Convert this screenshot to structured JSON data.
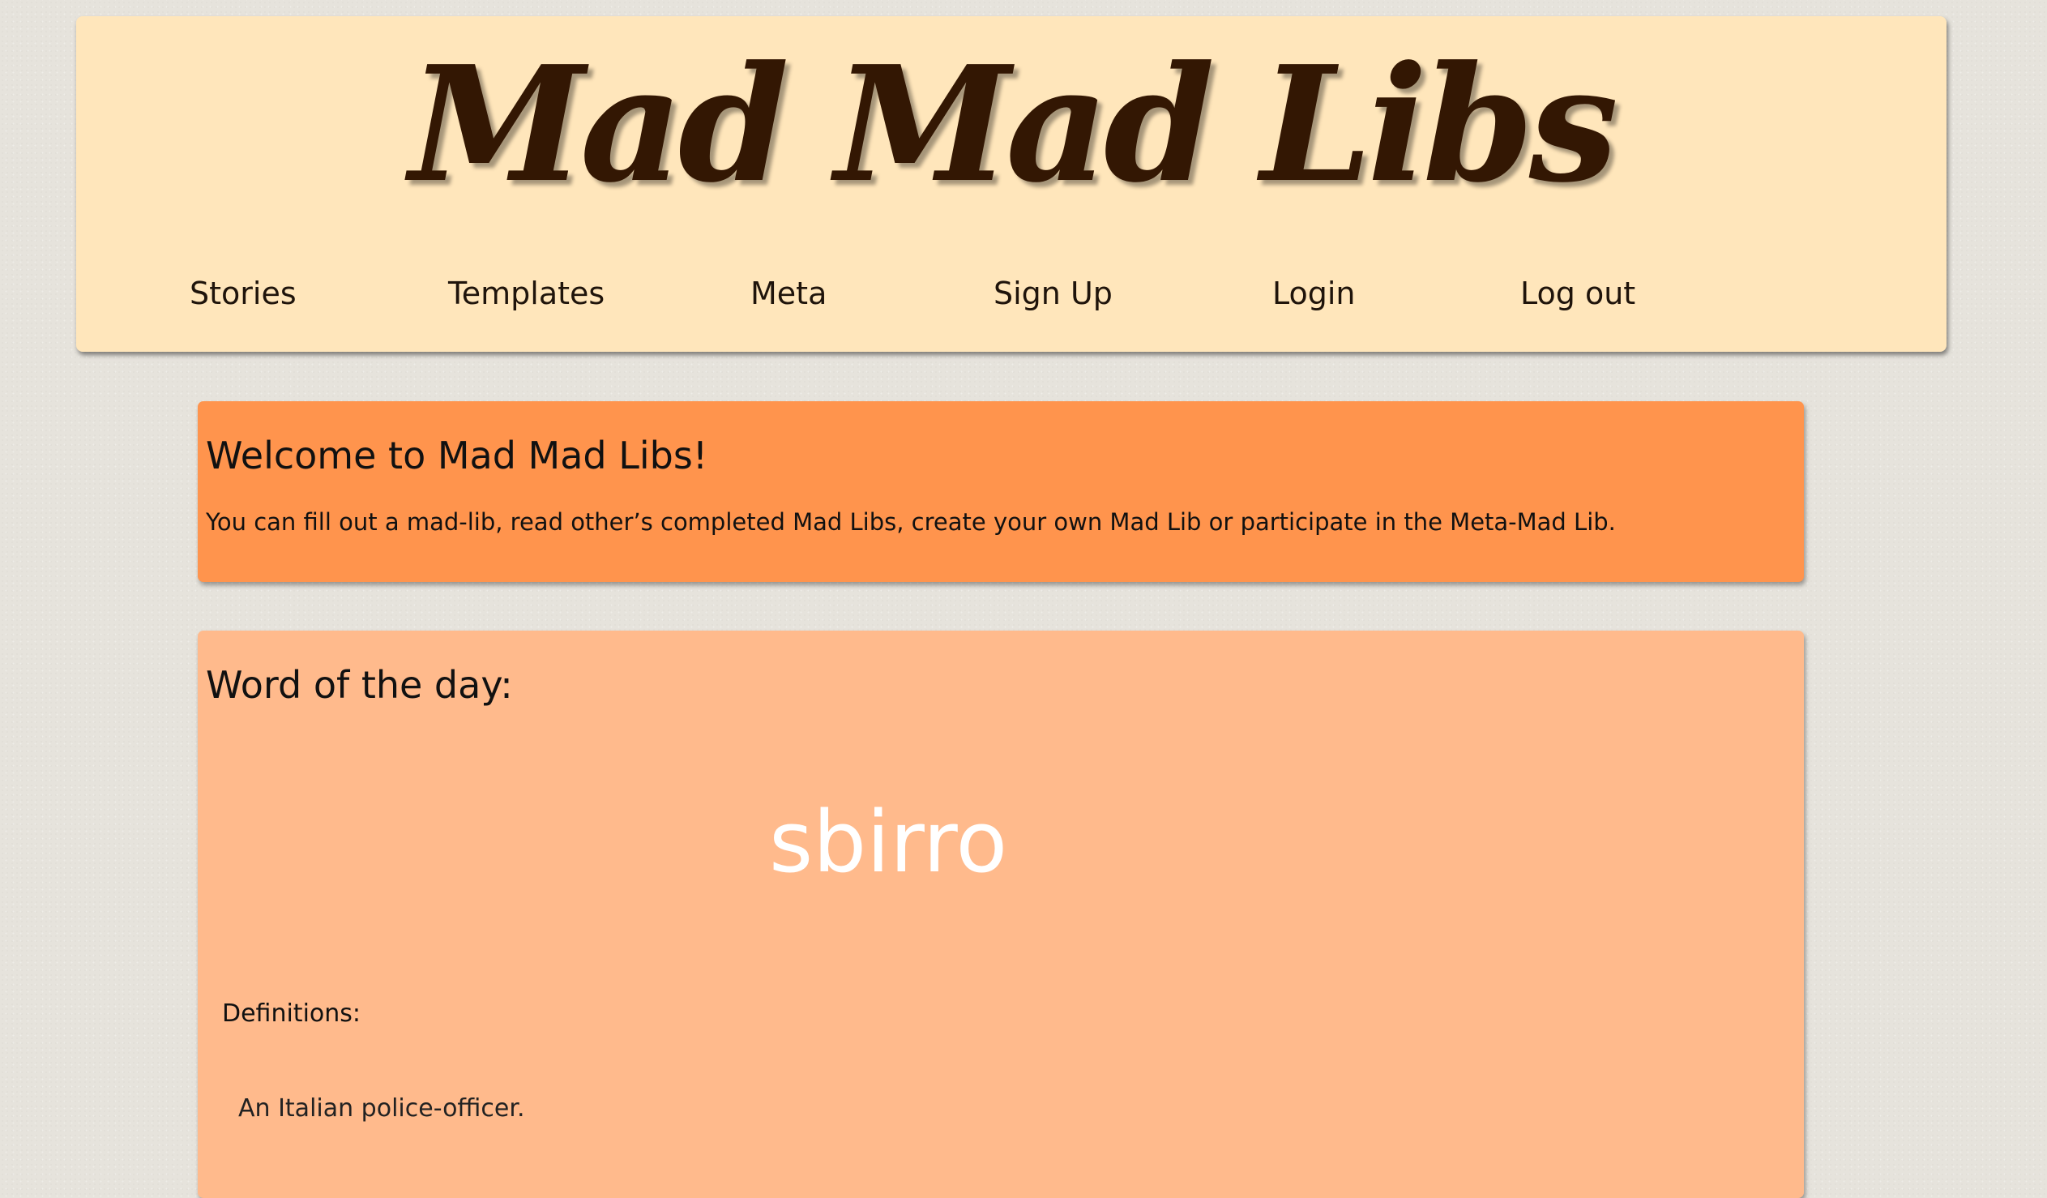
{
  "header": {
    "title": "Mad Mad Libs",
    "nav": [
      {
        "label": "Stories"
      },
      {
        "label": "Templates"
      },
      {
        "label": "Meta"
      },
      {
        "label": "Sign Up"
      },
      {
        "label": "Login"
      },
      {
        "label": "Log out"
      }
    ]
  },
  "welcome": {
    "title": "Welcome to Mad Mad Libs!",
    "text": "You can fill out a mad-lib, read other’s completed Mad Libs, create your own Mad Lib or participate in the Meta-Mad Lib."
  },
  "word_of_the_day": {
    "title": "Word of the day:",
    "word": "sbirro",
    "definitions_label": "Definitions:",
    "definitions": [
      "An Italian police-officer."
    ]
  },
  "colors": {
    "page_background": "#e6e3dc",
    "header_background": "#ffe6bb",
    "title_color": "#331703",
    "welcome_background": "#ff944d",
    "wotd_background": "#ffba8c",
    "word_color": "#ffffff"
  }
}
